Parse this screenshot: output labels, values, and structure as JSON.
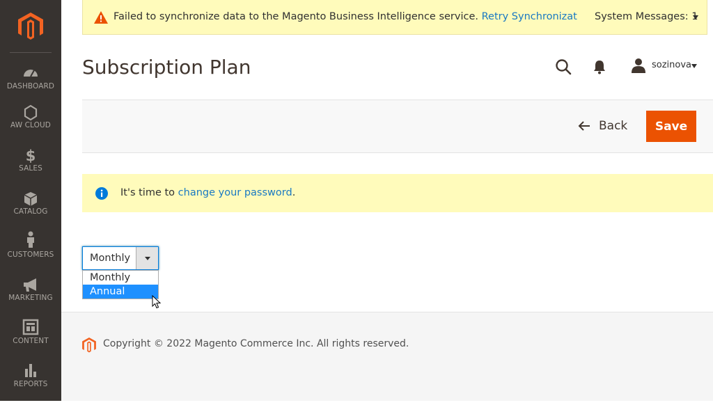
{
  "sidebar": {
    "items": [
      {
        "label": "DASHBOARD",
        "icon": "dashboard-icon"
      },
      {
        "label": "AW CLOUD",
        "icon": "hexagon-icon"
      },
      {
        "label": "SALES",
        "icon": "dollar-icon"
      },
      {
        "label": "CATALOG",
        "icon": "box-icon"
      },
      {
        "label": "CUSTOMERS",
        "icon": "person-icon"
      },
      {
        "label": "MARKETING",
        "icon": "megaphone-icon"
      },
      {
        "label": "CONTENT",
        "icon": "layout-icon"
      },
      {
        "label": "REPORTS",
        "icon": "bar-chart-icon"
      }
    ]
  },
  "system_message": {
    "text": "Failed to synchronize data to the Magento Business Intelligence service.",
    "link": "Retry Synchronizat",
    "count_label": "System Messages: 1"
  },
  "header": {
    "title": "Subscription Plan",
    "username": "sozinova"
  },
  "actions": {
    "back_label": "Back",
    "save_label": "Save"
  },
  "notice": {
    "prefix": "It's time to ",
    "link": "change your password",
    "suffix": "."
  },
  "plan_select": {
    "value": "Monthly",
    "options": [
      "Monthly",
      "Annual"
    ],
    "highlighted": "Annual"
  },
  "footer": {
    "copyright": "Copyright © 2022 Magento Commerce Inc. All rights reserved."
  },
  "colors": {
    "sidebar_bg": "#373330",
    "accent": "#eb5202",
    "link": "#1979c3",
    "notice_bg": "#fffbbb",
    "option_highlight": "#1e90ff"
  }
}
